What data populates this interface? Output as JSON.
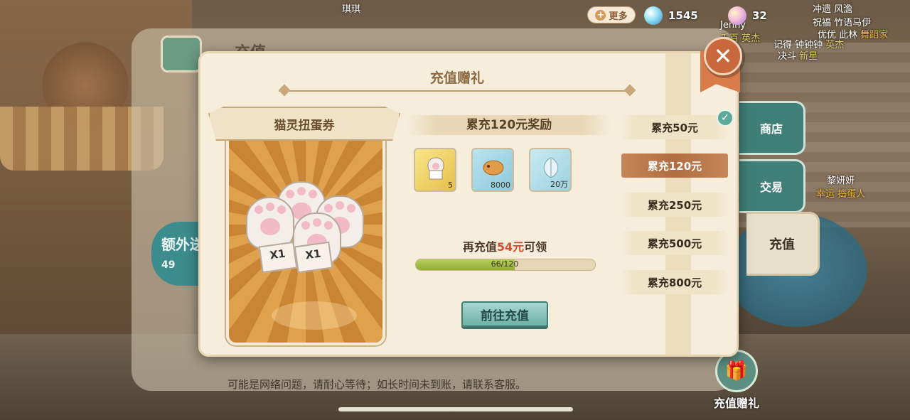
{
  "background": {
    "panel_title": "充值",
    "extra_label": "额外送",
    "extra_amount": "49",
    "side_tabs": [
      "商店",
      "交易",
      "充值"
    ],
    "gift_button_label": "充值赠礼",
    "notice": "可能是网络问题，请耐心等待；如长时间未到账，请联系客服。",
    "players": [
      {
        "name": "琪琪"
      },
      {
        "name": "Jenny",
        "title": "千百 英杰"
      },
      {
        "name": "冲遗 风澹",
        "title": "祝福 竹语马伊"
      },
      {
        "name": "优优 此林",
        "title": "舞蹈家"
      },
      {
        "name": "记得 钟钟钟",
        "title": "英杰"
      },
      {
        "name": "决斗",
        "title": "新星"
      },
      {
        "name": "黎妍妍",
        "title": "幸运 捣蛋人"
      }
    ]
  },
  "topbar": {
    "more_label": "更多",
    "currency_blue": "1545",
    "currency_pink": "32"
  },
  "dialog": {
    "title": "充值赠礼",
    "prize_name": "猫灵扭蛋券",
    "ticket_text": "X1",
    "reward_header": "累充120元奖励",
    "items": [
      {
        "icon": "paw-ticket-icon",
        "qty": "5"
      },
      {
        "icon": "taiyaki-icon",
        "qty": "8000"
      },
      {
        "icon": "leaf-icon",
        "qty": "20万"
      }
    ],
    "recharge_prefix": "再充值",
    "recharge_amount": "54元",
    "recharge_suffix": "可领",
    "progress_label": "66/120",
    "progress_fraction": 0.55,
    "go_button": "前往充值",
    "tiers": [
      "累充50元",
      "累充120元",
      "累充250元",
      "累充500元",
      "累充800元"
    ],
    "active_tier_index": 1
  },
  "colors": {
    "accent_orange": "#c9683c",
    "progress_green": "#8fae2e",
    "amount_red": "#d9492d",
    "button_teal": "#6eb2a6"
  }
}
